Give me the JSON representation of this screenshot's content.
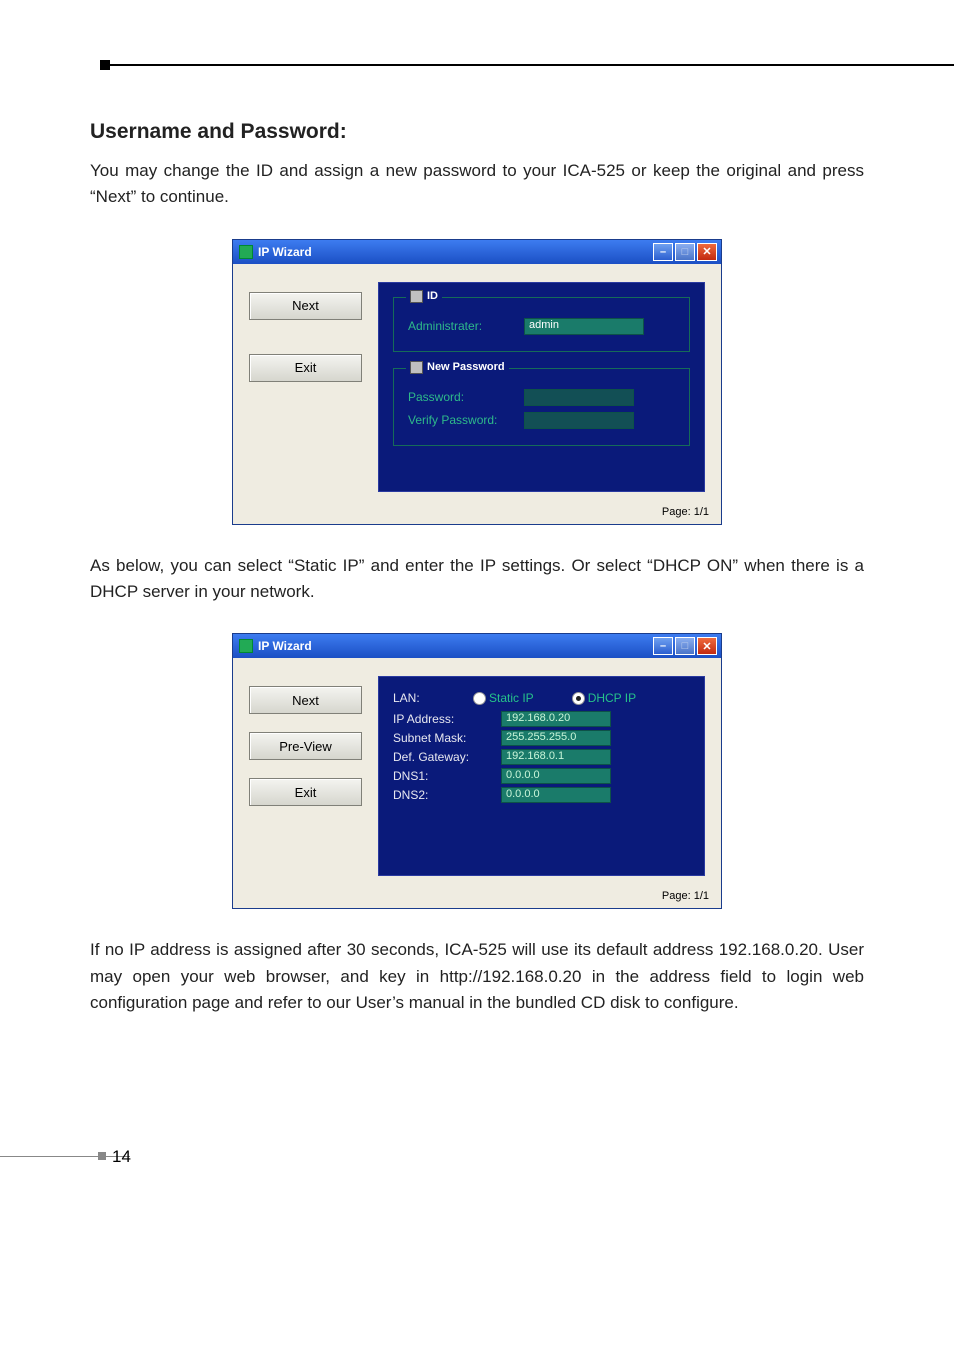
{
  "page": {
    "number": "14"
  },
  "sections": {
    "s1_heading": "Username and Password:",
    "s1_para": "You may change the ID and assign a new password to your ICA-525 or keep the original and press “Next” to continue.",
    "s2_para": "As below, you can select “Static IP” and enter the IP settings. Or select “DHCP ON” when there is a DHCP server in your network.",
    "s3_para": "If no IP address is assigned after 30 seconds, ICA-525 will use its default address 192.168.0.20. User may open your web browser, and key in http://192.168.0.20 in the address field to login web configuration page and refer to our User’s manual in the bundled CD disk to configure."
  },
  "wizard1": {
    "title": "IP Wizard",
    "sidebar": {
      "next": "Next",
      "exit": "Exit"
    },
    "id_group": {
      "legend": "ID",
      "admin_label": "Administrater:",
      "admin_value": "admin"
    },
    "pw_group": {
      "legend": "New Password",
      "password_label": "Password:",
      "password_value": "",
      "verify_label": "Verify Password:",
      "verify_value": ""
    },
    "footer": "Page: 1/1"
  },
  "wizard2": {
    "title": "IP Wizard",
    "sidebar": {
      "next": "Next",
      "preview": "Pre-View",
      "exit": "Exit"
    },
    "lan_label": "LAN:",
    "radio_static": "Static IP",
    "radio_dhcp": "DHCP IP",
    "radio_selected": "dhcp",
    "fields": {
      "ip_label": "IP Address:",
      "ip_value": "192.168.0.20",
      "mask_label": "Subnet Mask:",
      "mask_value": "255.255.255.0",
      "gw_label": "Def. Gateway:",
      "gw_value": "192.168.0.1",
      "dns1_label": "DNS1:",
      "dns1_value": "0.0.0.0",
      "dns2_label": "DNS2:",
      "dns2_value": "0.0.0.0"
    },
    "footer": "Page: 1/1"
  }
}
